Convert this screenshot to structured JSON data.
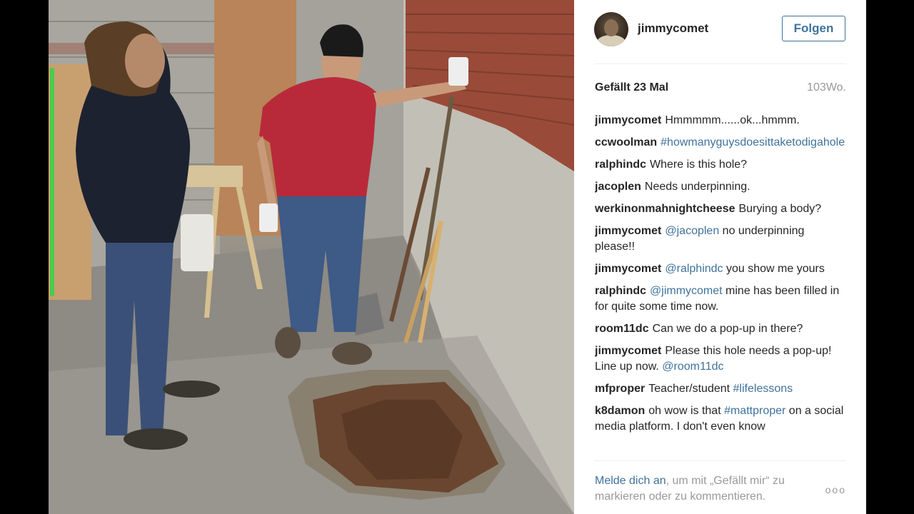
{
  "post": {
    "username": "jimmycomet",
    "follow_label": "Folgen",
    "likes": "Gefällt 23 Mal",
    "age": "103Wo."
  },
  "comments": [
    {
      "user": "jimmycomet",
      "segments": [
        {
          "text": "Hmmmmm......ok...hmmm.",
          "tag": false
        }
      ]
    },
    {
      "user": "ccwoolman",
      "segments": [
        {
          "text": "#howmanyguysdoesittaketodigahole",
          "tag": true
        }
      ]
    },
    {
      "user": "ralphindc",
      "segments": [
        {
          "text": "Where is this hole?",
          "tag": false
        }
      ]
    },
    {
      "user": "jacoplen",
      "segments": [
        {
          "text": "Needs underpinning.",
          "tag": false
        }
      ]
    },
    {
      "user": "werkinonmahnightcheese",
      "segments": [
        {
          "text": "Burying a body?",
          "tag": false
        }
      ]
    },
    {
      "user": "jimmycomet",
      "segments": [
        {
          "text": "@jacoplen",
          "tag": true
        },
        {
          "text": " no underpinning please!!",
          "tag": false
        }
      ]
    },
    {
      "user": "jimmycomet",
      "segments": [
        {
          "text": "@ralphindc",
          "tag": true
        },
        {
          "text": " you show me yours",
          "tag": false
        }
      ]
    },
    {
      "user": "ralphindc",
      "segments": [
        {
          "text": "@jimmycomet",
          "tag": true
        },
        {
          "text": " mine has been filled in for quite some time now.",
          "tag": false
        }
      ]
    },
    {
      "user": "room11dc",
      "segments": [
        {
          "text": "Can we do a pop-up in there?",
          "tag": false
        }
      ]
    },
    {
      "user": "jimmycomet",
      "segments": [
        {
          "text": "Please this hole needs a pop-up! Line up now. ",
          "tag": false
        },
        {
          "text": "@room11dc",
          "tag": true
        }
      ]
    },
    {
      "user": "mfproper",
      "segments": [
        {
          "text": "Teacher/student ",
          "tag": false
        },
        {
          "text": "#lifelessons",
          "tag": true
        }
      ]
    },
    {
      "user": "k8damon",
      "segments": [
        {
          "text": "oh wow is that ",
          "tag": false
        },
        {
          "text": "#mattproper",
          "tag": true
        },
        {
          "text": " on a social media platform. I don't even know",
          "tag": false
        }
      ]
    }
  ],
  "footer": {
    "login_link": "Melde dich an",
    "rest": ", um mit „Gefällt mir“ zu markieren oder zu kommentieren.",
    "more_label": "ooo"
  },
  "colors": {
    "link": "#3f729b",
    "text": "#262626",
    "muted": "#999999"
  }
}
